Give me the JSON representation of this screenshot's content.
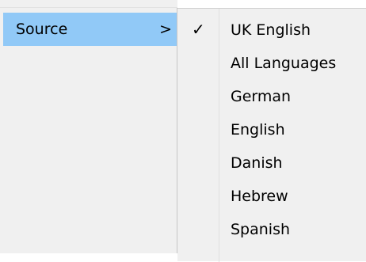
{
  "menu": {
    "items": [
      {
        "label": "Source",
        "arrow": ">"
      }
    ]
  },
  "submenu": {
    "checked_index": 0,
    "check_glyph": "✓",
    "items": [
      {
        "label": "UK English"
      },
      {
        "label": "All Languages"
      },
      {
        "label": "German"
      },
      {
        "label": "English"
      },
      {
        "label": "Danish"
      },
      {
        "label": "Hebrew"
      },
      {
        "label": "Spanish"
      }
    ]
  },
  "colors": {
    "menu_bg": "#f0f0f0",
    "highlight": "#91c9f7"
  }
}
